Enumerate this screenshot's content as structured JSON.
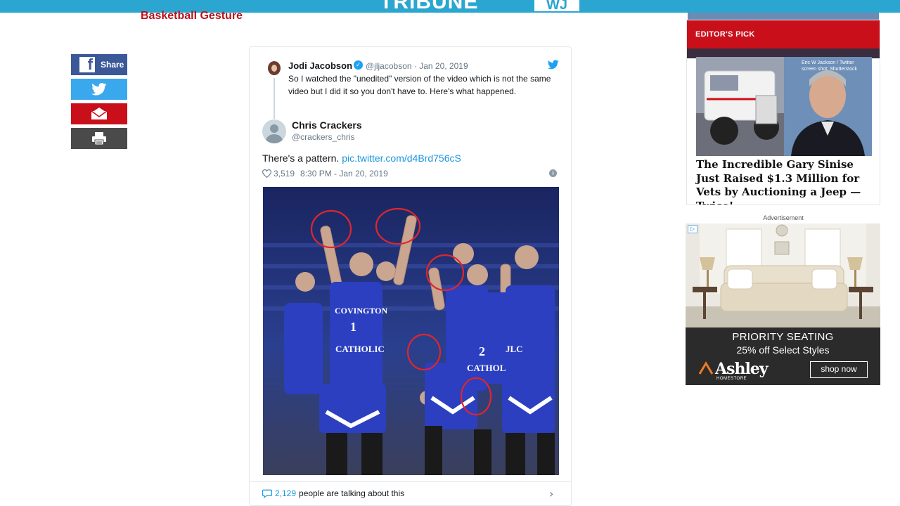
{
  "header": {
    "logo_text": "TRIBUNE",
    "logo_box": "WJ",
    "headline": "Basketball Gesture"
  },
  "share": {
    "facebook_label": "Share"
  },
  "tweet": {
    "author_name": "Jodi Jacobson",
    "author_handle": "@jljacobson",
    "date": "Jan 20, 2019",
    "text": "So I watched the \"unedited\" version of the video which is not the same video but I did it so you don't have to.  Here's what happened.",
    "quoted_name": "Chris Crackers",
    "quoted_handle": "@crackers_chris",
    "body_text": "There's a pattern. ",
    "body_link": "pic.twitter.com/d4Brd756cS",
    "likes": "3,519",
    "timestamp": "8:30 PM - Jan 20, 2019",
    "footer_count": "2,129",
    "footer_text": " people are talking about this",
    "jersey_text_1": "COVINGTON",
    "jersey_number_1": "1",
    "jersey_text_2": "CATHOLIC",
    "jersey_number_2": "2",
    "jersey_text_3": "CATHOL",
    "jersey_text_4": "JLC"
  },
  "editors_pick": {
    "label": "EDITOR'S PICK",
    "photo_credit": "Eric W Jackson / Twitter screen shot; Shutterstock",
    "title": "The Incredible Gary Sinise Just Raised $1.3 Million for Vets by Auctioning a Jeep — Twice!"
  },
  "advertisement": {
    "label": "Advertisement",
    "title": "PRIORITY SEATING",
    "subtitle": "25% off Select Styles",
    "brand": "Ashley",
    "brand_sub": "HOMESTORE",
    "cta": "shop now"
  },
  "colors": {
    "topbar": "#2aa6d0",
    "headline": "#b8121b",
    "facebook": "#3b5998",
    "twitter": "#3aa8ec",
    "email": "#c9101a",
    "print": "#4a4a4a",
    "twitter_link": "#1b95e0",
    "editors_pick_bar": "#c9101a",
    "jersey_blue": "#2b3fc0"
  }
}
